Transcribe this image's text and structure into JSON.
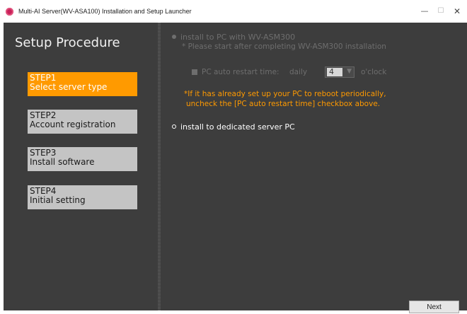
{
  "window": {
    "title": "Multi-AI Server(WV-ASA100) Installation and Setup Launcher",
    "icon": "app-logo-icon",
    "controls": {
      "minimize": "—",
      "maximize": "☐",
      "close": "✕"
    }
  },
  "sidebar": {
    "title": "Setup Procedure",
    "steps": [
      {
        "line1": "STEP1",
        "line2": "Select server type",
        "active": true
      },
      {
        "line1": "STEP2",
        "line2": "Account registration",
        "active": false
      },
      {
        "line1": "STEP3",
        "line2": "Install software",
        "active": false
      },
      {
        "line1": "STEP4",
        "line2": "Initial setting",
        "active": false
      }
    ]
  },
  "main": {
    "option_asm": {
      "label": "install to PC with WV-ASM300",
      "note": "* Please start after completing WV-ASM300 installation",
      "enabled": false
    },
    "auto_restart": {
      "label": "PC auto restart time:",
      "frequency": "daily",
      "hour": "4",
      "suffix": "o'clock",
      "checked": true
    },
    "warning": {
      "line1": "*If it has already set up your PC to reboot periodically,",
      "line2": "uncheck the [PC auto restart time] checkbox above."
    },
    "option_dedicated": {
      "label": "install to dedicated server PC",
      "selected": true
    }
  },
  "footer": {
    "next_label": "Next"
  },
  "colors": {
    "background": "#3d3d3d",
    "accent": "#ff9a00",
    "step_inactive": "#c4c4c4",
    "disabled_text": "#6e6e6e"
  }
}
